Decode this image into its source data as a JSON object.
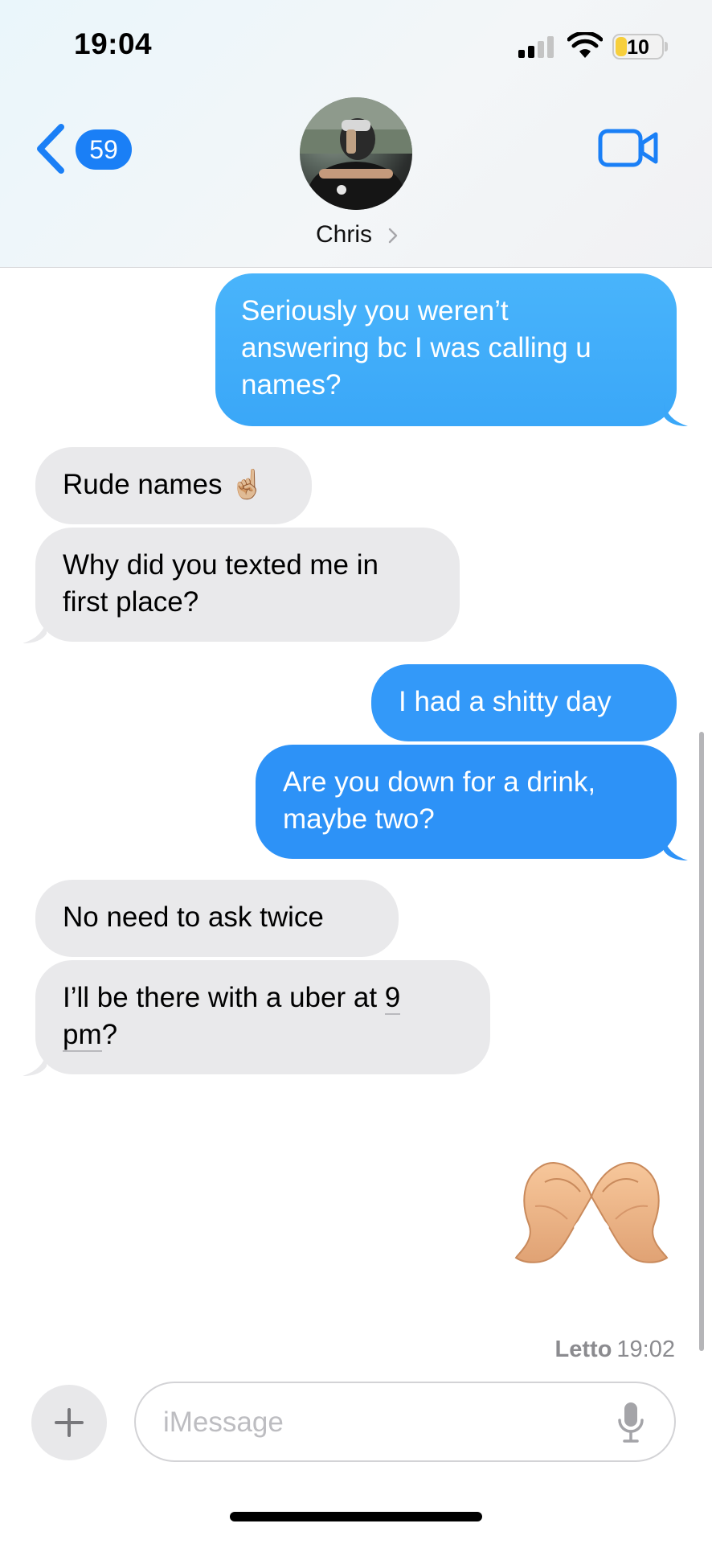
{
  "status_bar": {
    "time": "19:04",
    "battery": "10",
    "icons": [
      "cellular-signal-icon",
      "wifi-icon",
      "battery-icon"
    ]
  },
  "header": {
    "back_badge": "59",
    "contact_name": "Chris",
    "icons": [
      "chevron-left-icon",
      "chevron-right-icon",
      "video-camera-icon"
    ]
  },
  "messages": [
    {
      "from": "me",
      "lines": [
        "Seriously you weren’t",
        "answering bc I was calling u",
        "names?"
      ]
    },
    {
      "from": "them",
      "lines": [
        "Rude names ☝🏼"
      ]
    },
    {
      "from": "them",
      "lines": [
        "Why did you texted me in",
        "first place?"
      ]
    },
    {
      "from": "me",
      "lines": [
        "I had a shitty day"
      ]
    },
    {
      "from": "me",
      "lines": [
        "Are you down for a drink,",
        "maybe two?"
      ]
    },
    {
      "from": "them",
      "lines": [
        "No need to ask twice"
      ]
    },
    {
      "from": "them",
      "lines_parts": [
        [
          "I’ll be there with a uber at ",
          "9"
        ],
        [
          "pm",
          "?"
        ]
      ]
    },
    {
      "from": "me",
      "emoji": "heart-hands-emoji"
    }
  ],
  "read_receipt": {
    "label": "Letto",
    "time": "19:02"
  },
  "composer": {
    "placeholder": "iMessage",
    "icons": [
      "plus-icon",
      "microphone-icon"
    ]
  },
  "colors": {
    "sent_bubble": "#2f95f8",
    "received_bubble": "#e9e9eb",
    "accent": "#1a7ff6"
  }
}
